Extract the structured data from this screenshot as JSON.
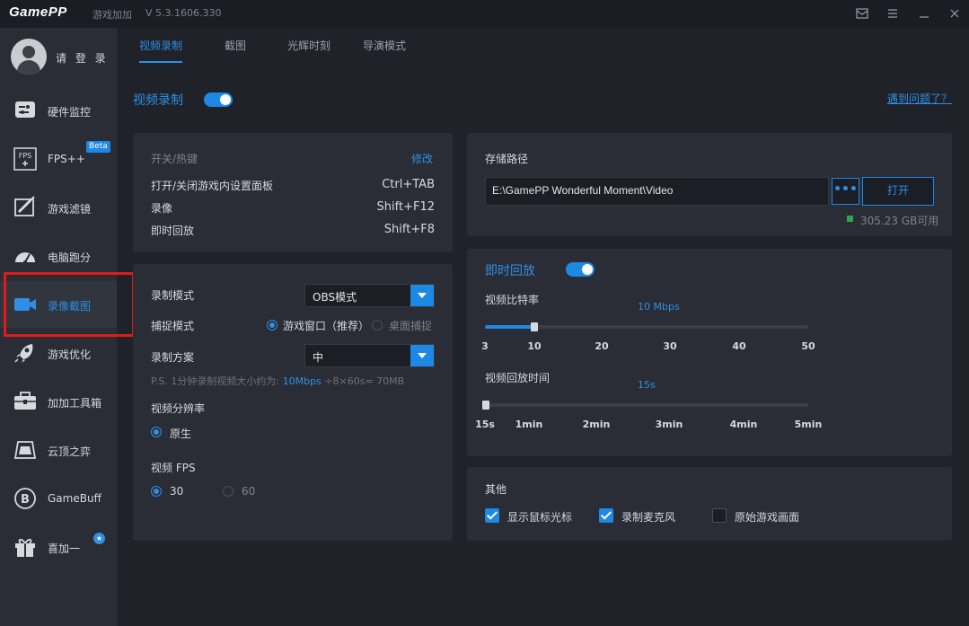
{
  "titlebar": {
    "logo_left": "Game",
    "logo_right": "PP",
    "subtitle": "游戏加加",
    "version": "V 5.3.1606.330",
    "icons": [
      "news-icon",
      "menu-icon",
      "minimize-icon",
      "close-icon"
    ]
  },
  "sidebar": {
    "login_label": "请 登 录",
    "items": [
      {
        "label": "硬件监控",
        "icon": "hardware-monitor-icon"
      },
      {
        "label": "FPS++",
        "icon": "fps-icon",
        "badge": "Beta"
      },
      {
        "label": "游戏滤镜",
        "icon": "filter-icon"
      },
      {
        "label": "电脑跑分",
        "icon": "benchmark-icon"
      },
      {
        "label": "录像截图",
        "icon": "video-camera-icon",
        "active": true
      },
      {
        "label": "游戏优化",
        "icon": "rocket-icon"
      },
      {
        "label": "加加工具箱",
        "icon": "toolbox-icon"
      },
      {
        "label": "云顶之弈",
        "icon": "tft-icon"
      },
      {
        "label": "GameBuff",
        "icon": "gamebuff-icon"
      },
      {
        "label": "喜加一",
        "icon": "gift-icon",
        "badge_icon": "new-badge"
      }
    ]
  },
  "tabs": [
    "视频录制",
    "截图",
    "光辉时刻",
    "导演模式"
  ],
  "header": {
    "title": "视频录制",
    "toggle_on": true,
    "help_link": "遇到问题了？"
  },
  "hotkeys": {
    "header": "开关/热键",
    "edit": "修改",
    "rows": [
      {
        "label": "打开/关闭游戏内设置面板",
        "value": "Ctrl+TAB"
      },
      {
        "label": "录像",
        "value": "Shift+F12"
      },
      {
        "label": "即时回放",
        "value": "Shift+F8"
      }
    ]
  },
  "record": {
    "mode_label": "录制模式",
    "mode_value": "OBS模式",
    "capture_label": "捕捉模式",
    "capture_opt1": "游戏窗口（推荐）",
    "capture_opt2": "桌面捕捉",
    "scheme_label": "录制方案",
    "scheme_value": "中",
    "note_prefix": "P.S. 1分钟录制视频大小约为:",
    "note_rate": "10Mbps",
    "note_suffix": "÷8×60s= 70MB",
    "res_label": "视频分辨率",
    "res_value": "原生",
    "fps_label": "视频 FPS",
    "fps_opt1": "30",
    "fps_opt2": "60"
  },
  "storage": {
    "label": "存储路径",
    "path": "E:\\GamePP Wonderful Moment\\Video",
    "dots": "•••",
    "open": "打开",
    "free": "305.23 GB可用"
  },
  "replay": {
    "title": "即时回放",
    "toggle_on": true,
    "bitrate_label": "视频比特率",
    "bitrate_value": "10 Mbps",
    "bitrate_value_num": 10,
    "bitrate_ticks": [
      "3",
      "10",
      "20",
      "30",
      "40",
      "50"
    ],
    "time_label": "视频回放时间",
    "time_value": "15s",
    "time_ticks": [
      "15s",
      "1min",
      "2min",
      "3min",
      "4min",
      "5min"
    ]
  },
  "other": {
    "label": "其他",
    "options": [
      {
        "label": "显示鼠标光标",
        "checked": true
      },
      {
        "label": "录制麦克风",
        "checked": true
      },
      {
        "label": "原始游戏画面",
        "checked": false
      }
    ]
  }
}
